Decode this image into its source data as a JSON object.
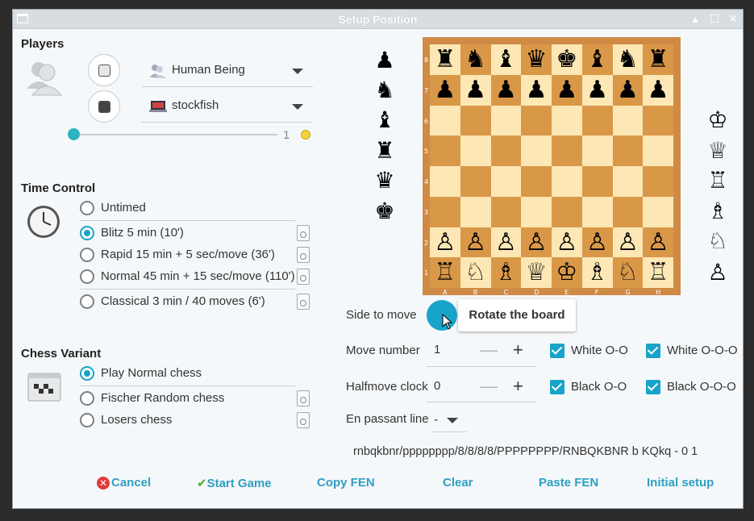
{
  "window": {
    "title": "Setup Position"
  },
  "players": {
    "title": "Players",
    "player1": {
      "name": "Human Being",
      "icon": "person-icon"
    },
    "player2": {
      "name": "stockfish",
      "icon": "computer-icon"
    },
    "level_value": "1",
    "level_fraction": 0.0
  },
  "time_control": {
    "title": "Time Control",
    "options": [
      {
        "label": "Untimed",
        "selected": false
      },
      {
        "label": "Blitz 5 min (10')",
        "selected": true
      },
      {
        "label": "Rapid 15 min + 5 sec/move (36')",
        "selected": false
      },
      {
        "label": "Normal 45 min + 15 sec/move (110')",
        "selected": false
      },
      {
        "label": "Classical 3 min / 40 moves (6')",
        "selected": false
      }
    ]
  },
  "chess_variant": {
    "title": "Chess Variant",
    "options": [
      {
        "label": "Play Normal chess",
        "selected": true
      },
      {
        "label": "Fischer Random chess",
        "selected": false
      },
      {
        "label": "Losers chess",
        "selected": false
      }
    ]
  },
  "board": {
    "files": [
      "A",
      "B",
      "C",
      "D",
      "E",
      "F",
      "G",
      "H"
    ],
    "ranks": [
      "8",
      "7",
      "6",
      "5",
      "4",
      "3",
      "2",
      "1"
    ],
    "rows": [
      [
        "♜",
        "♞",
        "♝",
        "♛",
        "♚",
        "♝",
        "♞",
        "♜"
      ],
      [
        "♟",
        "♟",
        "♟",
        "♟",
        "♟",
        "♟",
        "♟",
        "♟"
      ],
      [
        "",
        "",
        "",
        "",
        "",
        "",
        "",
        ""
      ],
      [
        "",
        "",
        "",
        "",
        "",
        "",
        "",
        ""
      ],
      [
        "",
        "",
        "",
        "",
        "",
        "",
        "",
        ""
      ],
      [
        "",
        "",
        "",
        "",
        "",
        "",
        "",
        ""
      ],
      [
        "♙",
        "♙",
        "♙",
        "♙",
        "♙",
        "♙",
        "♙",
        "♙"
      ],
      [
        "♖",
        "♘",
        "♗",
        "♕",
        "♔",
        "♗",
        "♘",
        "♖"
      ]
    ]
  },
  "black_palette": [
    "♟",
    "♞",
    "♝",
    "♜",
    "♛",
    "♚"
  ],
  "white_palette": [
    "♔",
    "♕",
    "♖",
    "♗",
    "♘",
    "♙"
  ],
  "settings": {
    "side_to_move_label": "Side to move",
    "rotate_tooltip": "Rotate the board",
    "move_number_label": "Move number",
    "move_number_value": "1",
    "halfmove_label": "Halfmove clock",
    "halfmove_value": "0",
    "en_passant_label": "En passant line",
    "en_passant_value": "-",
    "castling": {
      "white_oo": "White O-O",
      "white_ooo": "White O-O-O",
      "black_oo": "Black O-O",
      "black_ooo": "Black O-O-O"
    },
    "minus": "—",
    "plus": "+"
  },
  "fen": "rnbqkbnr/pppppppp/8/8/8/8/PPPPPPPP/RNBQKBNR b KQkq - 0 1",
  "footer": {
    "cancel": "Cancel",
    "start_game": "Start Game",
    "copy_fen": "Copy FEN",
    "clear": "Clear",
    "paste_fen": "Paste FEN",
    "initial_setup": "Initial setup"
  },
  "colors": {
    "accent": "#18a3c9",
    "link": "#2f9fc3",
    "board_light": "#fde7b5",
    "board_dark": "#d99848"
  }
}
